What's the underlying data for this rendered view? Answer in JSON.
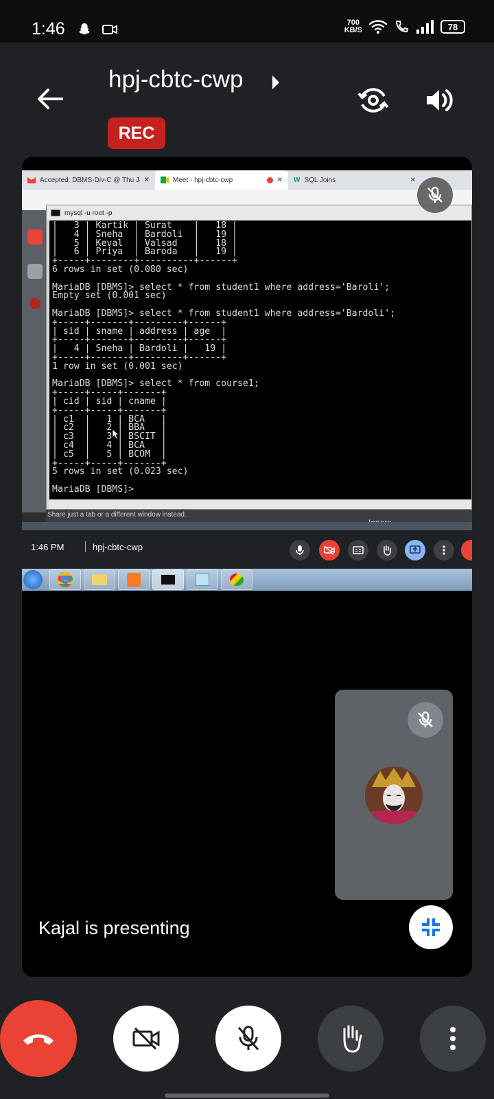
{
  "status_bar": {
    "time": "1:46",
    "net_speed_value": "700",
    "net_speed_unit": "KB/S",
    "battery": "78"
  },
  "header": {
    "meeting_title": "hpj-cbtc-cwp",
    "rec_label": "REC"
  },
  "shared_screen": {
    "browser_tabs": [
      {
        "label": "Accepted: DBMS-Div-C @ Thu Ja"
      },
      {
        "label": "Meet - hpj-cbtc-cwp"
      },
      {
        "label": "SQL Joins"
      }
    ],
    "cmd_title": "mysql -u root -p",
    "terminal_lines": [
      "|   3 | Kartik | Surat    |   18 |",
      "|   4 | Sneha  | Bardoli  |   19 |",
      "|   5 | Keval  | Valsad   |   18 |",
      "|   6 | Priya  | Baroda   |   19 |",
      "+-----+--------+----------+------+",
      "6 rows in set (0.080 sec)",
      "",
      "MariaDB [DBMS]> select * from student1 where address='Baroli';",
      "Empty set (0.001 sec)",
      "",
      "MariaDB [DBMS]> select * from student1 where address='Bardoli';",
      "+-----+-------+---------+------+",
      "| sid | sname | address | age  |",
      "+-----+-------+---------+------+",
      "|   4 | Sneha | Bardoli |   19 |",
      "+-----+-------+---------+------+",
      "1 row in set (0.001 sec)",
      "",
      "MariaDB [DBMS]> select * from course1;",
      "+-----+-----+-------+",
      "| cid | sid | cname |",
      "+-----+-----+-------+",
      "| c1  |   1 | BCA   |",
      "| c2  |   2 | BBA   |",
      "| c3  |   3 | BSCIT |",
      "| c4  |   4 | BCA   |",
      "| c5  |   5 | BCOM  |",
      "+-----+-----+-------+",
      "5 rows in set (0.023 sec)",
      "",
      "MariaDB [DBMS]>"
    ],
    "share_banner_text": "Share just a tab or a different window instead.",
    "ignore_label": "Ignore"
  },
  "meet_bar": {
    "time": "1:46 PM",
    "meeting_code": "hpj-cbtc-cwp"
  },
  "presenting_text": "Kajal is presenting",
  "colors": {
    "end_call": "#ea4335",
    "rec": "#c5221f",
    "screen_share_active": "#8ab4f8",
    "background": "#202124"
  }
}
